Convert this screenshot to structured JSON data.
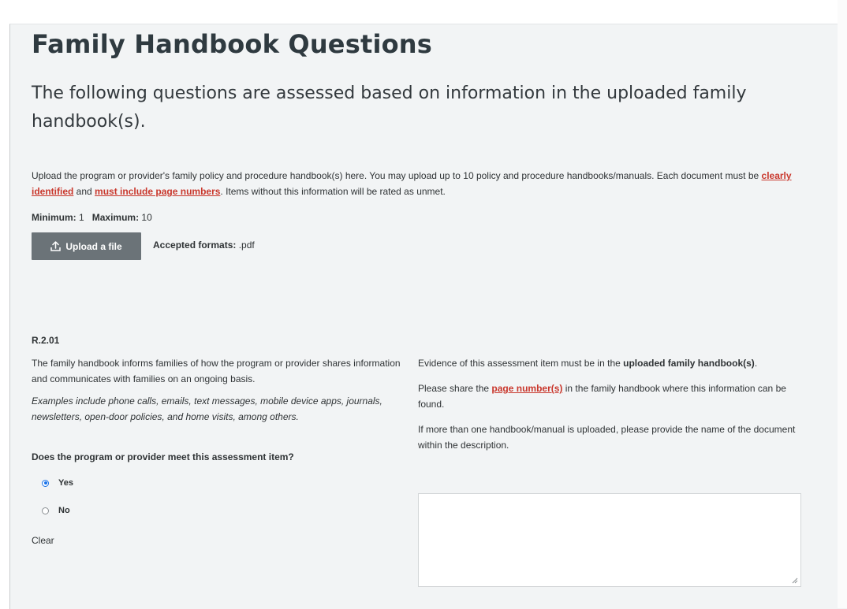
{
  "page": {
    "title": "Family Handbook Questions",
    "subtitle": "The following questions are assessed based on information in the uploaded family handbook(s)."
  },
  "upload_section": {
    "intro_part1": "Upload the program or provider's family policy and procedure handbook(s) here. You may upload up to 10 policy and procedure handbooks/manuals.  Each document must be ",
    "link_clearly_identified": "clearly identified",
    "intro_part2": " and ",
    "link_must_include_page_numbers": "must include page numbers",
    "intro_part3": ".  Items without this information will be rated as unmet.",
    "minimum_label": "Minimum:",
    "minimum_value": "1",
    "maximum_label": "Maximum:",
    "maximum_value": "10",
    "upload_button_label": "Upload a file",
    "accepted_formats_label": "Accepted formats:",
    "accepted_formats_value": ".pdf",
    "icon": "upload-icon"
  },
  "assessment_item": {
    "id": "R.2.01",
    "description": "The family handbook informs families of how the program or provider shares information and communicates with families on an ongoing basis.",
    "examples": "Examples include phone calls, emails, text messages, mobile device apps, journals, newsletters, open-door policies, and home visits, among others.",
    "question": "Does the program or provider meet this assessment item?",
    "options": [
      {
        "label": "Yes",
        "selected": true
      },
      {
        "label": "No",
        "selected": false
      }
    ],
    "clear_label": "Clear",
    "evidence_part1": "Evidence of this assessment item must be in the ",
    "evidence_bold": "uploaded family handbook(s)",
    "evidence_part2": ".",
    "share_part1": "Please share the ",
    "share_link": "page number(s)",
    "share_part2": " in the family handbook where this information can be found.",
    "multiple_note": "If more than one handbook/manual is uploaded, please provide the name of the document within the description.",
    "response_value": ""
  },
  "colors": {
    "panel_background": "#f2f4f5",
    "link_red": "#c9372c",
    "button_gray": "#6b7378",
    "radio_blue": "#1a73e8"
  }
}
